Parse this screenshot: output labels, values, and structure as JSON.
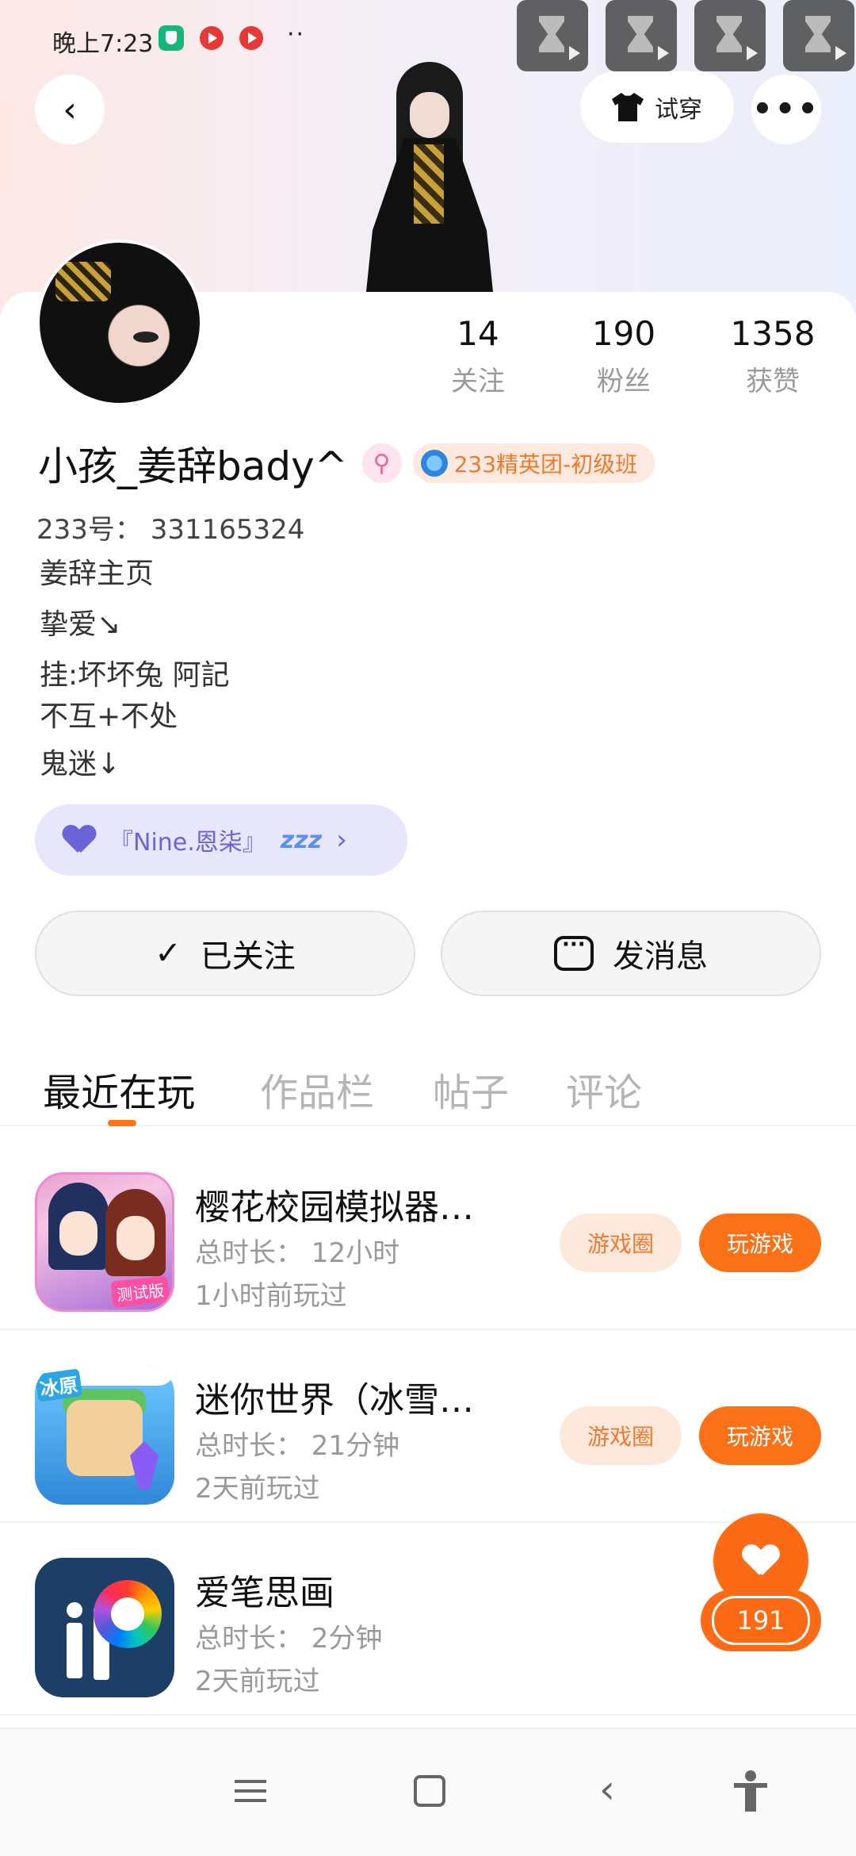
{
  "status_bar": {
    "time": "晚上7:23"
  },
  "header": {
    "tryon_label": "试穿"
  },
  "profile": {
    "name": "小孩_姜辞bady^",
    "gender_symbol": "⚲",
    "badge_label": "233精英团-初级班",
    "uid": "233号： 331165324",
    "bio": [
      "姜辞主页",
      "挚爱↘",
      "挂:坏坏兔 阿記",
      "不互+不处",
      "鬼迷↓"
    ]
  },
  "stats": [
    {
      "value": "14",
      "label": "关注"
    },
    {
      "value": "190",
      "label": "粉丝"
    },
    {
      "value": "1358",
      "label": "获赞"
    }
  ],
  "music": {
    "label": "『Nine.恩柒』",
    "emoji": "zᴢᴢ"
  },
  "actions": {
    "follow_label": "已关注",
    "follow_check": "✓",
    "message_label": "发消息"
  },
  "tabs": [
    "最近在玩",
    "作品栏",
    "帖子",
    "评论"
  ],
  "active_tab": 0,
  "games": [
    {
      "title": "樱花校园模拟器…",
      "duration": "总时长： 12小时",
      "last_played": "1小时前玩过",
      "icon": "sakura-school-icon",
      "icon_tag": "测试版",
      "circle_label": "游戏圈",
      "play_label": "玩游戏"
    },
    {
      "title": "迷你世界（冰雪…",
      "duration": "总时长： 21分钟",
      "last_played": "2天前玩过",
      "icon": "mini-world-icon",
      "icon_tag": "冰原",
      "circle_label": "游戏圈",
      "play_label": "玩游戏"
    },
    {
      "title": "爱笔思画",
      "duration": "总时长： 2分钟",
      "last_played": "2天前玩过",
      "icon": "ibis-paint-icon"
    }
  ],
  "like_fab": {
    "count": "191"
  },
  "colors": {
    "accent": "#fb7117",
    "badge_text": "#f07a2b",
    "music_text": "#6b63d8"
  }
}
